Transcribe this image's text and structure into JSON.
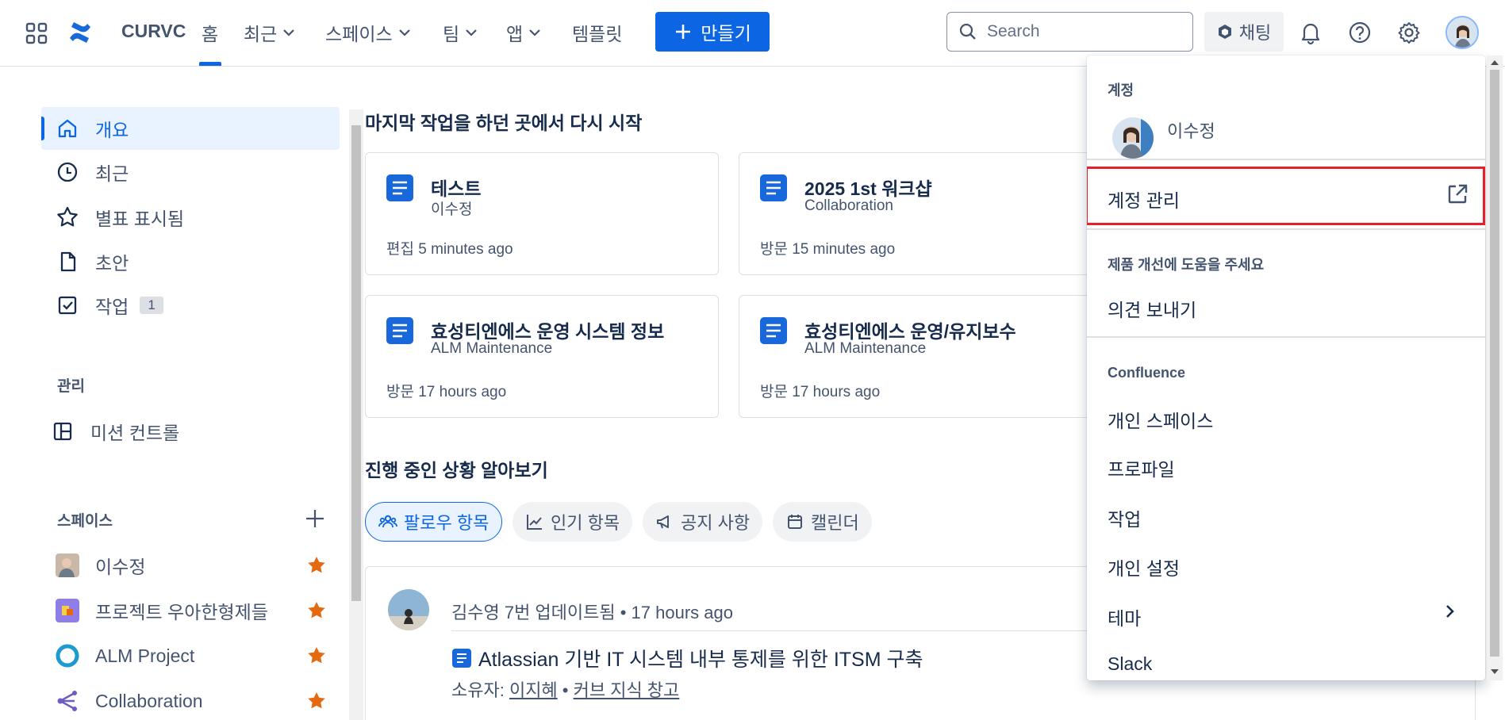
{
  "topnav": {
    "site_name": "CURVC",
    "items": [
      {
        "label": "홈",
        "has_chevron": false
      },
      {
        "label": "최근",
        "has_chevron": true
      },
      {
        "label": "스페이스",
        "has_chevron": true
      },
      {
        "label": "팀",
        "has_chevron": true
      },
      {
        "label": "앱",
        "has_chevron": true
      },
      {
        "label": "템플릿",
        "has_chevron": false
      }
    ],
    "create_label": "만들기",
    "search_placeholder": "Search",
    "chat_label": "채팅"
  },
  "sidebar": {
    "items": [
      {
        "label": "개요",
        "icon": "home-icon",
        "active": true
      },
      {
        "label": "최근",
        "icon": "clock-icon"
      },
      {
        "label": "별표 표시됨",
        "icon": "star-icon"
      },
      {
        "label": "초안",
        "icon": "draft-icon"
      },
      {
        "label": "작업",
        "icon": "task-icon",
        "badge": "1"
      }
    ],
    "manage_heading": "관리",
    "manage_items": [
      {
        "label": "미션 컨트롤",
        "icon": "layout-icon"
      }
    ],
    "spaces_heading": "스페이스",
    "spaces": [
      {
        "label": "이수정",
        "color": "#c9b8a8",
        "starred": true
      },
      {
        "label": "프로젝트 우아한형제들",
        "color": "#8f7ee7",
        "starred": true
      },
      {
        "label": "ALM Project",
        "color": "#1d9bd1",
        "starred": true
      },
      {
        "label": "Collaboration",
        "color": "#6e5dc6",
        "starred": true
      }
    ]
  },
  "main": {
    "resume_title": "마지막 작업을 하던 곳에서 다시 시작",
    "cards": [
      {
        "title": "테스트",
        "subtitle": "이수정",
        "meta": "편집 5 minutes ago"
      },
      {
        "title": "2025 1st 워크샵",
        "subtitle": "Collaboration",
        "meta": "방문 15 minutes ago"
      },
      {
        "title": "효성티엔에스 운영 시스템 정보",
        "subtitle": "ALM Maintenance",
        "meta": "방문 17 hours ago"
      },
      {
        "title": "효성티엔에스 운영/유지보수",
        "subtitle": "ALM Maintenance",
        "meta": "방문 17 hours ago"
      }
    ],
    "progress_title": "진행 중인 상황 알아보기",
    "chips": [
      {
        "label": "팔로우 항목",
        "icon": "people-icon",
        "selected": true
      },
      {
        "label": "인기 항목",
        "icon": "chart-line-icon",
        "selected": false
      },
      {
        "label": "공지 사항",
        "icon": "megaphone-icon",
        "selected": false
      },
      {
        "label": "캘린더",
        "icon": "calendar-icon",
        "selected": false
      }
    ],
    "feed": {
      "head": "김수영 7번 업데이트됨 • 17 hours ago",
      "title": "Atlassian 기반 IT 시스템 내부 통제를 위한 ITSM 구축",
      "owner_prefix": "소유자: ",
      "owner": "이지혜",
      "separator": " • ",
      "tag": "커브 지식 창고"
    }
  },
  "dropdown": {
    "account_heading": "계정",
    "user_name": "이수정",
    "manage_account": "계정 관리",
    "help_heading": "제품 개선에 도움을 주세요",
    "feedback": "의견 보내기",
    "confluence_heading": "Confluence",
    "items": [
      "개인 스페이스",
      "프로파일",
      "작업",
      "개인 설정",
      "테마",
      "Slack"
    ]
  }
}
